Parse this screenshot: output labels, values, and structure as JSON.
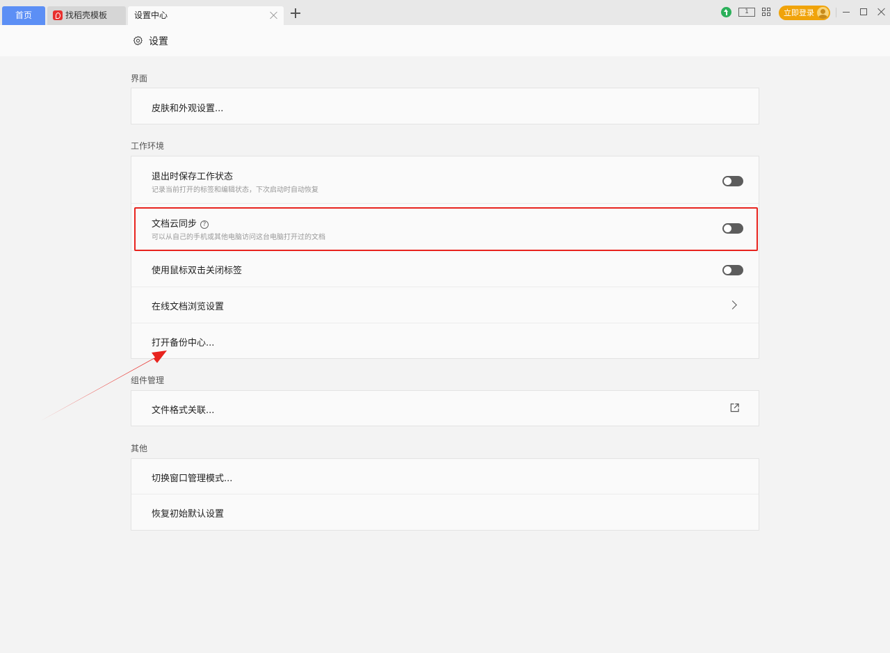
{
  "tabs": {
    "home": "首页",
    "template": "找稻壳模板",
    "settings": "设置中心"
  },
  "toolbar": {
    "screen_label": "1",
    "login_label": "立即登录"
  },
  "header": {
    "title": "设置"
  },
  "sections": {
    "interface": {
      "label": "界面",
      "items": [
        {
          "label": "皮肤和外观设置..."
        }
      ]
    },
    "workspace": {
      "label": "工作环境",
      "items": [
        {
          "label": "退出时保存工作状态",
          "sub": "记录当前打开的标签和编辑状态，下次启动时自动恢复",
          "control": "toggle",
          "state": "off"
        },
        {
          "label": "文档云同步",
          "sub": "可以从自己的手机或其他电脑访问这台电脑打开过的文档",
          "control": "toggle",
          "state": "off",
          "help": "?"
        },
        {
          "label": "使用鼠标双击关闭标签",
          "control": "toggle",
          "state": "off"
        },
        {
          "label": "在线文档浏览设置",
          "control": "chevron"
        },
        {
          "label": "打开备份中心..."
        }
      ]
    },
    "components": {
      "label": "组件管理",
      "items": [
        {
          "label": "文件格式关联...",
          "control": "external"
        }
      ]
    },
    "other": {
      "label": "其他",
      "items": [
        {
          "label": "切换窗口管理模式..."
        },
        {
          "label": "恢复初始默认设置"
        }
      ]
    }
  },
  "colors": {
    "accent": "#5c8ff5",
    "highlight": "#e8231e",
    "login": "#f0a30a"
  }
}
